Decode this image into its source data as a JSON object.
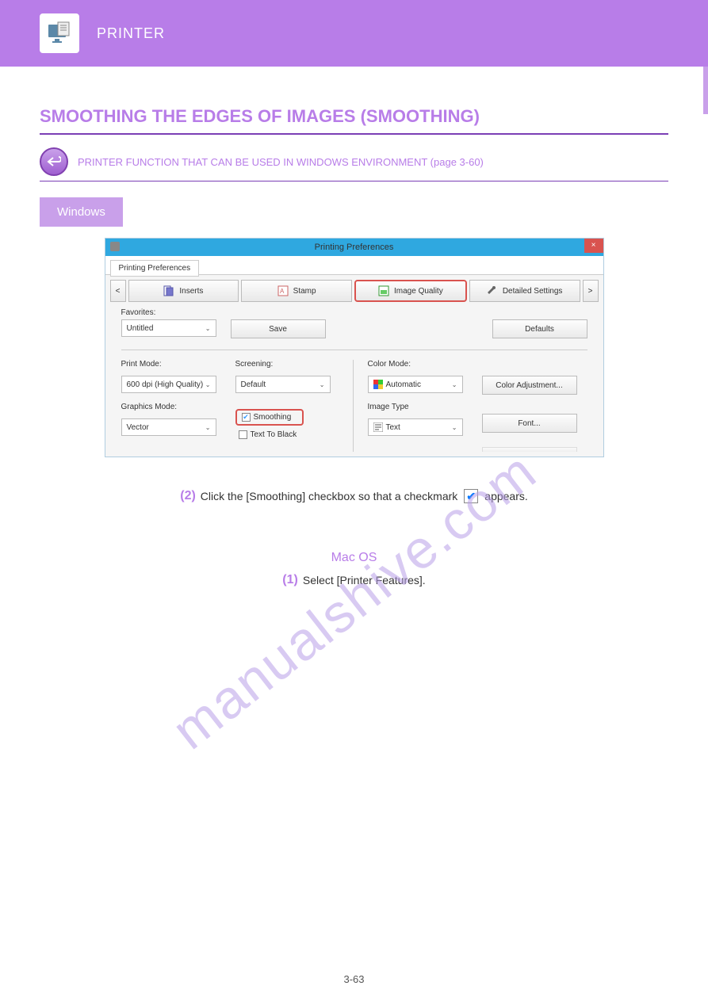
{
  "topbar": {
    "title": "PRINTER"
  },
  "section": {
    "title": "SMOOTHING THE EDGES OF IMAGES (SMOOTHING)",
    "back": "PRINTER FUNCTION THAT CAN BE USED IN WINDOWS ENVIRONMENT (page 3-60)"
  },
  "win_label": "Windows",
  "screenshot": {
    "title": "Printing Preferences",
    "tab": "Printing Preferences",
    "nav_prev": "<",
    "nav_next": ">",
    "tabs": {
      "inserts": "Inserts",
      "stamp": "Stamp",
      "image_quality": "Image Quality",
      "detailed": "Detailed Settings"
    },
    "favorites_lbl": "Favorites:",
    "favorites_val": "Untitled",
    "save": "Save",
    "defaults": "Defaults",
    "print_mode_lbl": "Print Mode:",
    "print_mode_val": "600 dpi (High Quality)",
    "screening_lbl": "Screening:",
    "screening_val": "Default",
    "color_mode_lbl": "Color Mode:",
    "color_mode_val": "Automatic",
    "color_adj": "Color Adjustment...",
    "graphics_lbl": "Graphics Mode:",
    "graphics_val": "Vector",
    "smoothing": "Smoothing",
    "text_black": "Text To Black",
    "image_type_lbl": "Image Type",
    "image_type_val": "Text",
    "font_btn": "Font..."
  },
  "step": {
    "num": "(2)",
    "before": "Click the [Smoothing] checkbox so that a checkmark ",
    "after": " appears."
  },
  "mac": {
    "label": "Mac OS",
    "num": "(1)",
    "text": "Select [Printer Features]."
  },
  "pagenum": "3-63",
  "watermark": "manualshive.com"
}
